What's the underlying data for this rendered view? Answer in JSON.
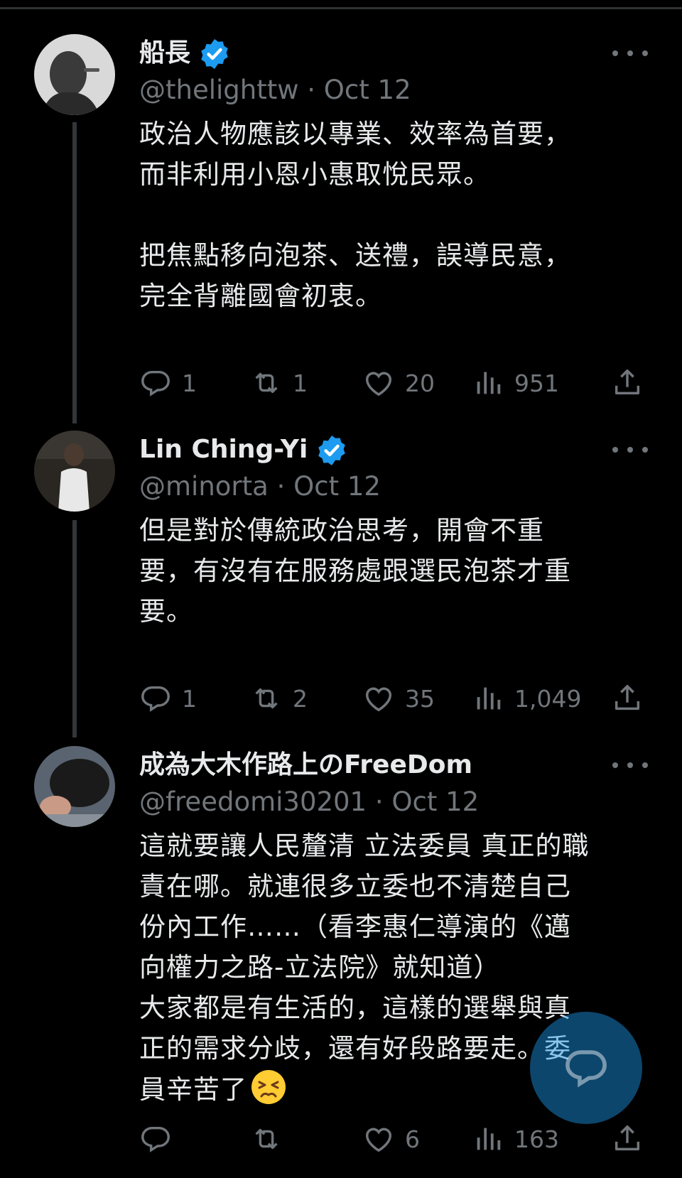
{
  "tweets": [
    {
      "display_name": "船長",
      "verified": true,
      "handle": "@thelighttw",
      "separator": "·",
      "date": "Oct 12",
      "text": "政治人物應該以專業、效率為首要，\n而非利用小恩小惠取悅民眾。\n\n把焦點移向泡茶、送禮，誤導民意，\n完全背離國會初衷。",
      "replies": "1",
      "reposts": "1",
      "likes": "20",
      "views": "951",
      "avatar": "avatar-photo"
    },
    {
      "display_name": "Lin Ching-Yi",
      "verified": true,
      "handle": "@minorta",
      "separator": "·",
      "date": "Oct 12",
      "text": "但是對於傳統政治思考，開會不重\n要，有沒有在服務處跟選民泡茶才重\n要。",
      "replies": "1",
      "reposts": "2",
      "likes": "35",
      "views": "1,049",
      "avatar": "avatar-photo"
    },
    {
      "display_name": "成為大木作路上のFreeDom",
      "verified": false,
      "handle": "@freedomi30201",
      "separator": "·",
      "date": "Oct 12",
      "text": "這就要讓人民釐清 立法委員 真正的職\n責在哪。就連很多立委也不清楚自己\n份內工作……（看李惠仁導演的《邁\n向權力之路-立法院》就知道）\n大家都是有生活的，這樣的選舉與真\n正的需求分歧，還有好段路要走。委\n員辛苦了",
      "emoji": "persevering-face-emoji",
      "replies": "",
      "reposts": "",
      "likes": "6",
      "views": "163",
      "avatar": "avatar-photo"
    }
  ],
  "icons": {
    "reply": "reply-icon",
    "repost": "repost-icon",
    "like": "heart-icon",
    "views": "views-icon",
    "share": "share-icon",
    "more": "more-icon",
    "verified": "verified-badge-icon",
    "compose": "compose-reply-icon"
  },
  "colors": {
    "background": "#000000",
    "text": "#e7e9ea",
    "secondary": "#71767b",
    "verified": "#1d9bf0",
    "fab": "#1d9bf0"
  }
}
